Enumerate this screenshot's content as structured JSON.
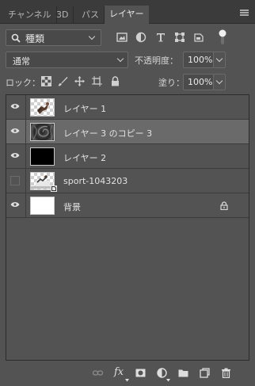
{
  "tabs": [
    {
      "label": "チャンネル",
      "active": false
    },
    {
      "label": "3D",
      "active": false
    },
    {
      "label": "パス",
      "active": false
    },
    {
      "label": "レイヤー",
      "active": true
    }
  ],
  "filter": {
    "kind_label": "種類",
    "icons": [
      "pixel-filter-icon",
      "adjustment-filter-icon",
      "type-filter-icon",
      "shape-filter-icon",
      "smart-object-filter-icon",
      "filter-toggle-icon"
    ]
  },
  "blend": {
    "mode": "通常",
    "opacity_label": "不透明度：",
    "opacity_value": "100%"
  },
  "lock": {
    "label": "ロック：",
    "icons": [
      "lock-transparent-icon",
      "lock-image-icon",
      "lock-position-icon",
      "lock-artboard-icon",
      "lock-all-icon"
    ],
    "fill_label": "塗り：",
    "fill_value": "100%"
  },
  "layers": [
    {
      "name": "レイヤー 1",
      "visible": true,
      "selected": false,
      "thumb": "checker-figure",
      "locked": false
    },
    {
      "name": "レイヤー 3 のコピー 3",
      "visible": true,
      "selected": true,
      "thumb": "swirl",
      "locked": false
    },
    {
      "name": "レイヤー 2",
      "visible": true,
      "selected": false,
      "thumb": "black",
      "locked": false
    },
    {
      "name": "sport-1043203",
      "visible": false,
      "selected": false,
      "thumb": "checker-photo",
      "locked": false
    },
    {
      "name": "背景",
      "visible": true,
      "selected": false,
      "thumb": "white",
      "locked": true
    }
  ],
  "bottom_icons": [
    "link-layers-icon",
    "fx-icon",
    "add-mask-icon",
    "adjustment-layer-icon",
    "new-group-icon",
    "new-layer-icon",
    "delete-icon"
  ],
  "fx_label": "fx"
}
